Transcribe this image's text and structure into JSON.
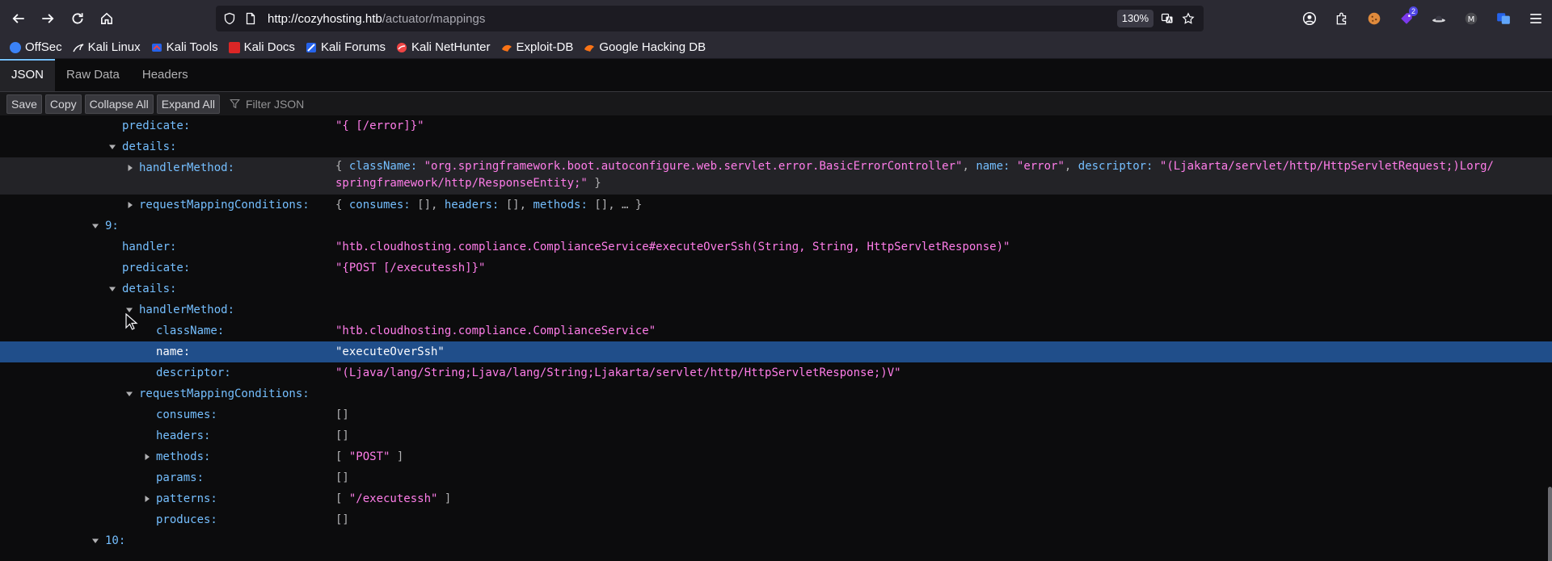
{
  "browser": {
    "url_host": "http://cozyhosting.htb",
    "url_path": "/actuator/mappings",
    "zoom": "130%",
    "bookmarks": [
      {
        "label": "OffSec",
        "icon": "offsec-icon",
        "color": "#3b82f6"
      },
      {
        "label": "Kali Linux",
        "icon": "kali-dragon-icon",
        "color": "#fbfbfe"
      },
      {
        "label": "Kali Tools",
        "icon": "kali-tools-icon",
        "color": "#ef4444"
      },
      {
        "label": "Kali Docs",
        "icon": "kali-docs-icon",
        "color": "#dc2626"
      },
      {
        "label": "Kali Forums",
        "icon": "kali-forums-icon",
        "color": "#3b82f6"
      },
      {
        "label": "Kali NetHunter",
        "icon": "nethunter-icon",
        "color": "#ef4444"
      },
      {
        "label": "Exploit-DB",
        "icon": "exploitdb-icon",
        "color": "#f97316"
      },
      {
        "label": "Google Hacking DB",
        "icon": "ghdb-icon",
        "color": "#f97316"
      }
    ]
  },
  "viewer": {
    "tabs": [
      "JSON",
      "Raw Data",
      "Headers"
    ],
    "toolbar": {
      "save": "Save",
      "copy": "Copy",
      "collapse": "Collapse All",
      "expand": "Expand All",
      "filter_placeholder": "Filter JSON"
    }
  },
  "tree": {
    "r0": {
      "key": "predicate:",
      "value": "\"{ [/error]}\""
    },
    "r1": {
      "key": "details:"
    },
    "r2": {
      "key": "handlerMethod:",
      "line1": [
        {
          "t": "{ ",
          "c": "p"
        },
        {
          "t": "className:",
          "c": "k"
        },
        {
          "t": " \"org.springframework.boot.autoconfigure.web.servlet.error.BasicErrorController\"",
          "c": "s"
        },
        {
          "t": ", ",
          "c": "p"
        },
        {
          "t": "name:",
          "c": "k"
        },
        {
          "t": " \"error\"",
          "c": "s"
        },
        {
          "t": ", ",
          "c": "p"
        },
        {
          "t": "descriptor:",
          "c": "k"
        },
        {
          "t": " \"(Ljakarta/servlet/http/HttpServletRequest;)Lorg/",
          "c": "s"
        }
      ],
      "line2": [
        {
          "t": "springframework/http/ResponseEntity;\"",
          "c": "s"
        },
        {
          "t": " }",
          "c": "p"
        }
      ]
    },
    "r3": {
      "key": "requestMappingConditions:",
      "value": [
        {
          "t": "{ ",
          "c": "p"
        },
        {
          "t": "consumes:",
          "c": "k"
        },
        {
          "t": " [], ",
          "c": "p"
        },
        {
          "t": "headers:",
          "c": "k"
        },
        {
          "t": " [], ",
          "c": "p"
        },
        {
          "t": "methods:",
          "c": "k"
        },
        {
          "t": " [], … }",
          "c": "p"
        }
      ]
    },
    "r4": {
      "key": "9:"
    },
    "r5": {
      "key": "handler:",
      "value": "\"htb.cloudhosting.compliance.ComplianceService#executeOverSsh(String, String, HttpServletResponse)\""
    },
    "r6": {
      "key": "predicate:",
      "value": "\"{POST [/executessh]}\""
    },
    "r7": {
      "key": "details:"
    },
    "r8": {
      "key": "handlerMethod:"
    },
    "r9": {
      "key": "className:",
      "value": "\"htb.cloudhosting.compliance.ComplianceService\""
    },
    "r10": {
      "key": "name:",
      "value": "\"executeOverSsh\""
    },
    "r11": {
      "key": "descriptor:",
      "value": "\"(Ljava/lang/String;Ljava/lang/String;Ljakarta/servlet/http/HttpServletResponse;)V\""
    },
    "r12": {
      "key": "requestMappingConditions:"
    },
    "r13": {
      "key": "consumes:",
      "value": "[]"
    },
    "r14": {
      "key": "headers:",
      "value": "[]"
    },
    "r15": {
      "key": "methods:",
      "value_open": "[ ",
      "value_str": "\"POST\"",
      "value_close": " ]"
    },
    "r16": {
      "key": "params:",
      "value": "[]"
    },
    "r17": {
      "key": "patterns:",
      "value_open": "[ ",
      "value_str": "\"/executessh\"",
      "value_close": " ]"
    },
    "r18": {
      "key": "produces:",
      "value": "[]"
    },
    "r19": {
      "key": "10:"
    }
  }
}
